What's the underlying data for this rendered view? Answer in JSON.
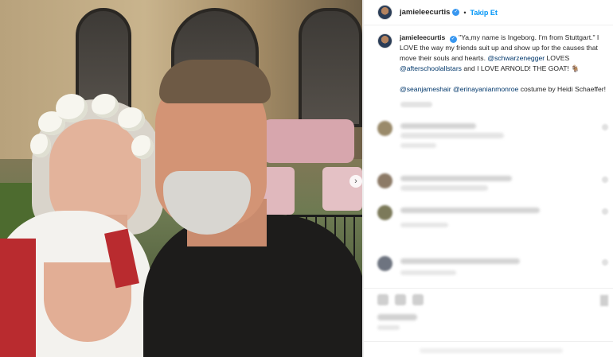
{
  "header": {
    "username": "jamieleecurtis",
    "separator": "•",
    "follow_label": "Takip Et"
  },
  "caption": {
    "username": "jamieleecurtis",
    "text_1": " \"Ya,my name is Ingeborg. I'm from Stuttgart.\" I LOVE the way my friends suit up and show up for the causes that move their souls and hearts. ",
    "mention_1": "@schwarzenegger",
    "text_2": " LOVES ",
    "mention_2": "@afterschoolallstars",
    "text_3": " and I LOVE ARNOLD! THE GOAT! 🐐",
    "mention_3": "@seanjameshair",
    "mention_4": "@erinayanianmonroe",
    "text_4": " costume by Heidi Schaeffer!"
  },
  "icons": {
    "verified": "verified-badge-icon",
    "next": "chevron-right-icon"
  },
  "photo_next_glyph": "›",
  "verified_glyph": "✓",
  "colors": {
    "accent": "#0095f6",
    "mention": "#00376b",
    "verified": "#3897f0"
  }
}
